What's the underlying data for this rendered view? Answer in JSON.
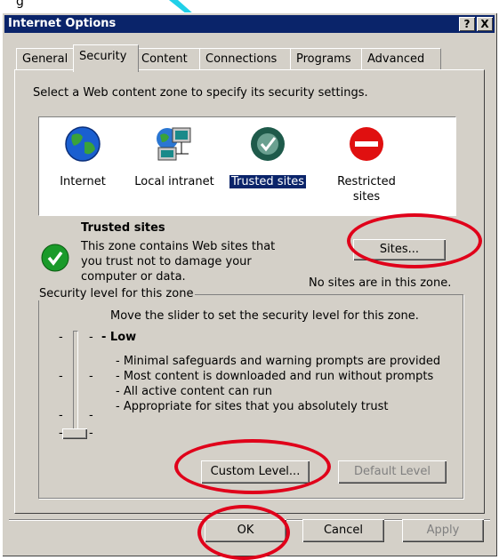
{
  "title": "Internet Options",
  "top_fragment": "g",
  "title_buttons": [
    "?",
    "X"
  ],
  "tabs": [
    "General",
    "Security",
    "Content",
    "Connections",
    "Programs",
    "Advanced"
  ],
  "instruction": "Select a Web content zone to specify its security settings.",
  "zones": [
    {
      "label": "Internet",
      "icon": "globe-icon"
    },
    {
      "label": "Local intranet",
      "icon": "network-computer-icon"
    },
    {
      "label": "Trusted sites",
      "icon": "checkmark-icon",
      "selected": true
    },
    {
      "label": "Restricted\nsites",
      "icon": "no-entry-icon"
    }
  ],
  "zone_info": {
    "heading": "Trusted sites",
    "description": "This zone contains Web sites that\nyou trust not to damage your\ncomputer or data.",
    "sites_button": "Sites...",
    "no_sites_text": "No sites are in this zone."
  },
  "security_level": {
    "legend": "Security level for this zone",
    "slider_hint": "Move the slider to set the security level for this zone.",
    "level_name": "Low",
    "bullets": [
      "- Minimal safeguards and warning prompts are provided",
      "- Most content is downloaded and run without prompts",
      "- All active content can run",
      "- Appropriate for sites that you absolutely trust"
    ],
    "custom_button": "Custom Level...",
    "default_button": "Default Level"
  },
  "footer": {
    "ok": "OK",
    "cancel": "Cancel",
    "apply": "Apply"
  },
  "colors": {
    "titlebar": "#0a246a",
    "highlight_circle": "#e0001a",
    "face": "#d4d0c8"
  }
}
